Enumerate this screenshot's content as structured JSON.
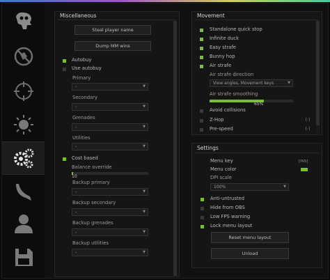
{
  "colors": {
    "accent": "#78c030",
    "menu_color_swatch": "#78c030",
    "unchecked": "#3a3a3a"
  },
  "sidebar": {
    "tabs": [
      {
        "icon": "skull-mask-icon"
      },
      {
        "icon": "no-symbol-icon"
      },
      {
        "icon": "crosshair-icon"
      },
      {
        "icon": "sun-half-icon"
      },
      {
        "icon": "gears-icon",
        "active": true
      },
      {
        "icon": "knife-icon"
      },
      {
        "icon": "user-icon"
      },
      {
        "icon": "floppy-disk-icon"
      }
    ]
  },
  "misc": {
    "title": "Miscellaneous",
    "steal_button": "Steal player name",
    "dump_button": "Dump MM wins",
    "autobuy": {
      "label": "Autobuy",
      "checked": true
    },
    "use_autobuy": {
      "label": "Use autobuy",
      "checked": false
    },
    "primary": {
      "label": "Primary",
      "value": "-"
    },
    "secondary": {
      "label": "Secondary",
      "value": "-"
    },
    "grenades": {
      "label": "Grenades",
      "value": "-"
    },
    "utilities": {
      "label": "Utilities",
      "value": "-"
    },
    "cost_based": {
      "label": "Cost based",
      "checked": true
    },
    "balance_override": {
      "label": "Balance override",
      "value": "10",
      "fraction": 0.02
    },
    "backup_primary": {
      "label": "Backup primary",
      "value": "-"
    },
    "backup_secondary": {
      "label": "Backup secondary",
      "value": "-"
    },
    "backup_grenades": {
      "label": "Backup grenades",
      "value": "-"
    },
    "backup_utilities": {
      "label": "Backup utilities",
      "value": "-"
    }
  },
  "movement": {
    "title": "Movement",
    "items": [
      {
        "label": "Standalone quick stop",
        "checked": true
      },
      {
        "label": "Infinite duck",
        "checked": true
      },
      {
        "label": "Easy strafe",
        "checked": true
      },
      {
        "label": "Bunny hop",
        "checked": true
      },
      {
        "label": "Air strafe",
        "checked": true
      }
    ],
    "air_strafe_direction": {
      "label": "Air strafe direction",
      "value": "View angles, Movement keys"
    },
    "air_strafe_smoothing": {
      "label": "Air strafe smoothing",
      "value": "65%",
      "fraction": 0.65
    },
    "lower_items": [
      {
        "label": "Avoid collisions",
        "checked": false,
        "key": ""
      },
      {
        "label": "Z-Hop",
        "checked": false,
        "key": "[-]"
      },
      {
        "label": "Pre-speed",
        "checked": false,
        "key": "[-]"
      }
    ]
  },
  "settings": {
    "title": "Settings",
    "menu_key": {
      "label": "Menu key",
      "key": "[INS]"
    },
    "menu_color": {
      "label": "Menu color"
    },
    "dpi_scale": {
      "label": "DPI scale",
      "value": "100%"
    },
    "items": [
      {
        "label": "Anti-untrusted",
        "checked": true
      },
      {
        "label": "Hide from OBS",
        "checked": false
      },
      {
        "label": "Low FPS warning",
        "checked": false
      },
      {
        "label": "Lock menu layout",
        "checked": true
      }
    ],
    "reset_button": "Reset menu layout",
    "unload_button": "Unload"
  }
}
